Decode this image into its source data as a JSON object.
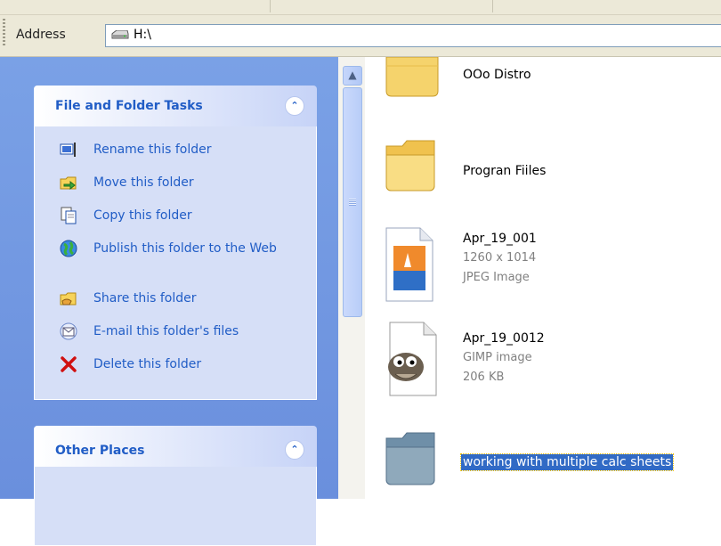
{
  "address_bar": {
    "label": "Address",
    "path": "H:\\"
  },
  "tasks_panel": {
    "title": "File and Folder Tasks",
    "tasks": [
      {
        "label": "Rename this folder",
        "icon": "rename-icon"
      },
      {
        "label": "Move this folder",
        "icon": "move-icon"
      },
      {
        "label": "Copy this folder",
        "icon": "copy-icon"
      },
      {
        "label": "Publish this folder to the Web",
        "icon": "globe-icon"
      },
      {
        "label": "Share this folder",
        "icon": "share-icon"
      },
      {
        "label": "E-mail this folder's files",
        "icon": "email-icon"
      },
      {
        "label": "Delete this folder",
        "icon": "delete-icon"
      }
    ]
  },
  "other_places_panel": {
    "title": "Other Places"
  },
  "files": [
    {
      "name": "OOo Distro",
      "type": "folder"
    },
    {
      "name": "Progran Fiiles",
      "type": "folder"
    },
    {
      "name": "Apr_19_001",
      "line1": "1260 x 1014",
      "line2": "JPEG Image",
      "type": "jpeg"
    },
    {
      "name": "Apr_19_0012",
      "line1": "GIMP image",
      "line2": "206 KB",
      "type": "gimp"
    },
    {
      "name": "working with multiple calc sheets",
      "type": "folder",
      "selected": true
    }
  ],
  "colors": {
    "task_link": "#215dc6",
    "pane_blue": "#7aa1e6",
    "selection": "#316ac5"
  }
}
